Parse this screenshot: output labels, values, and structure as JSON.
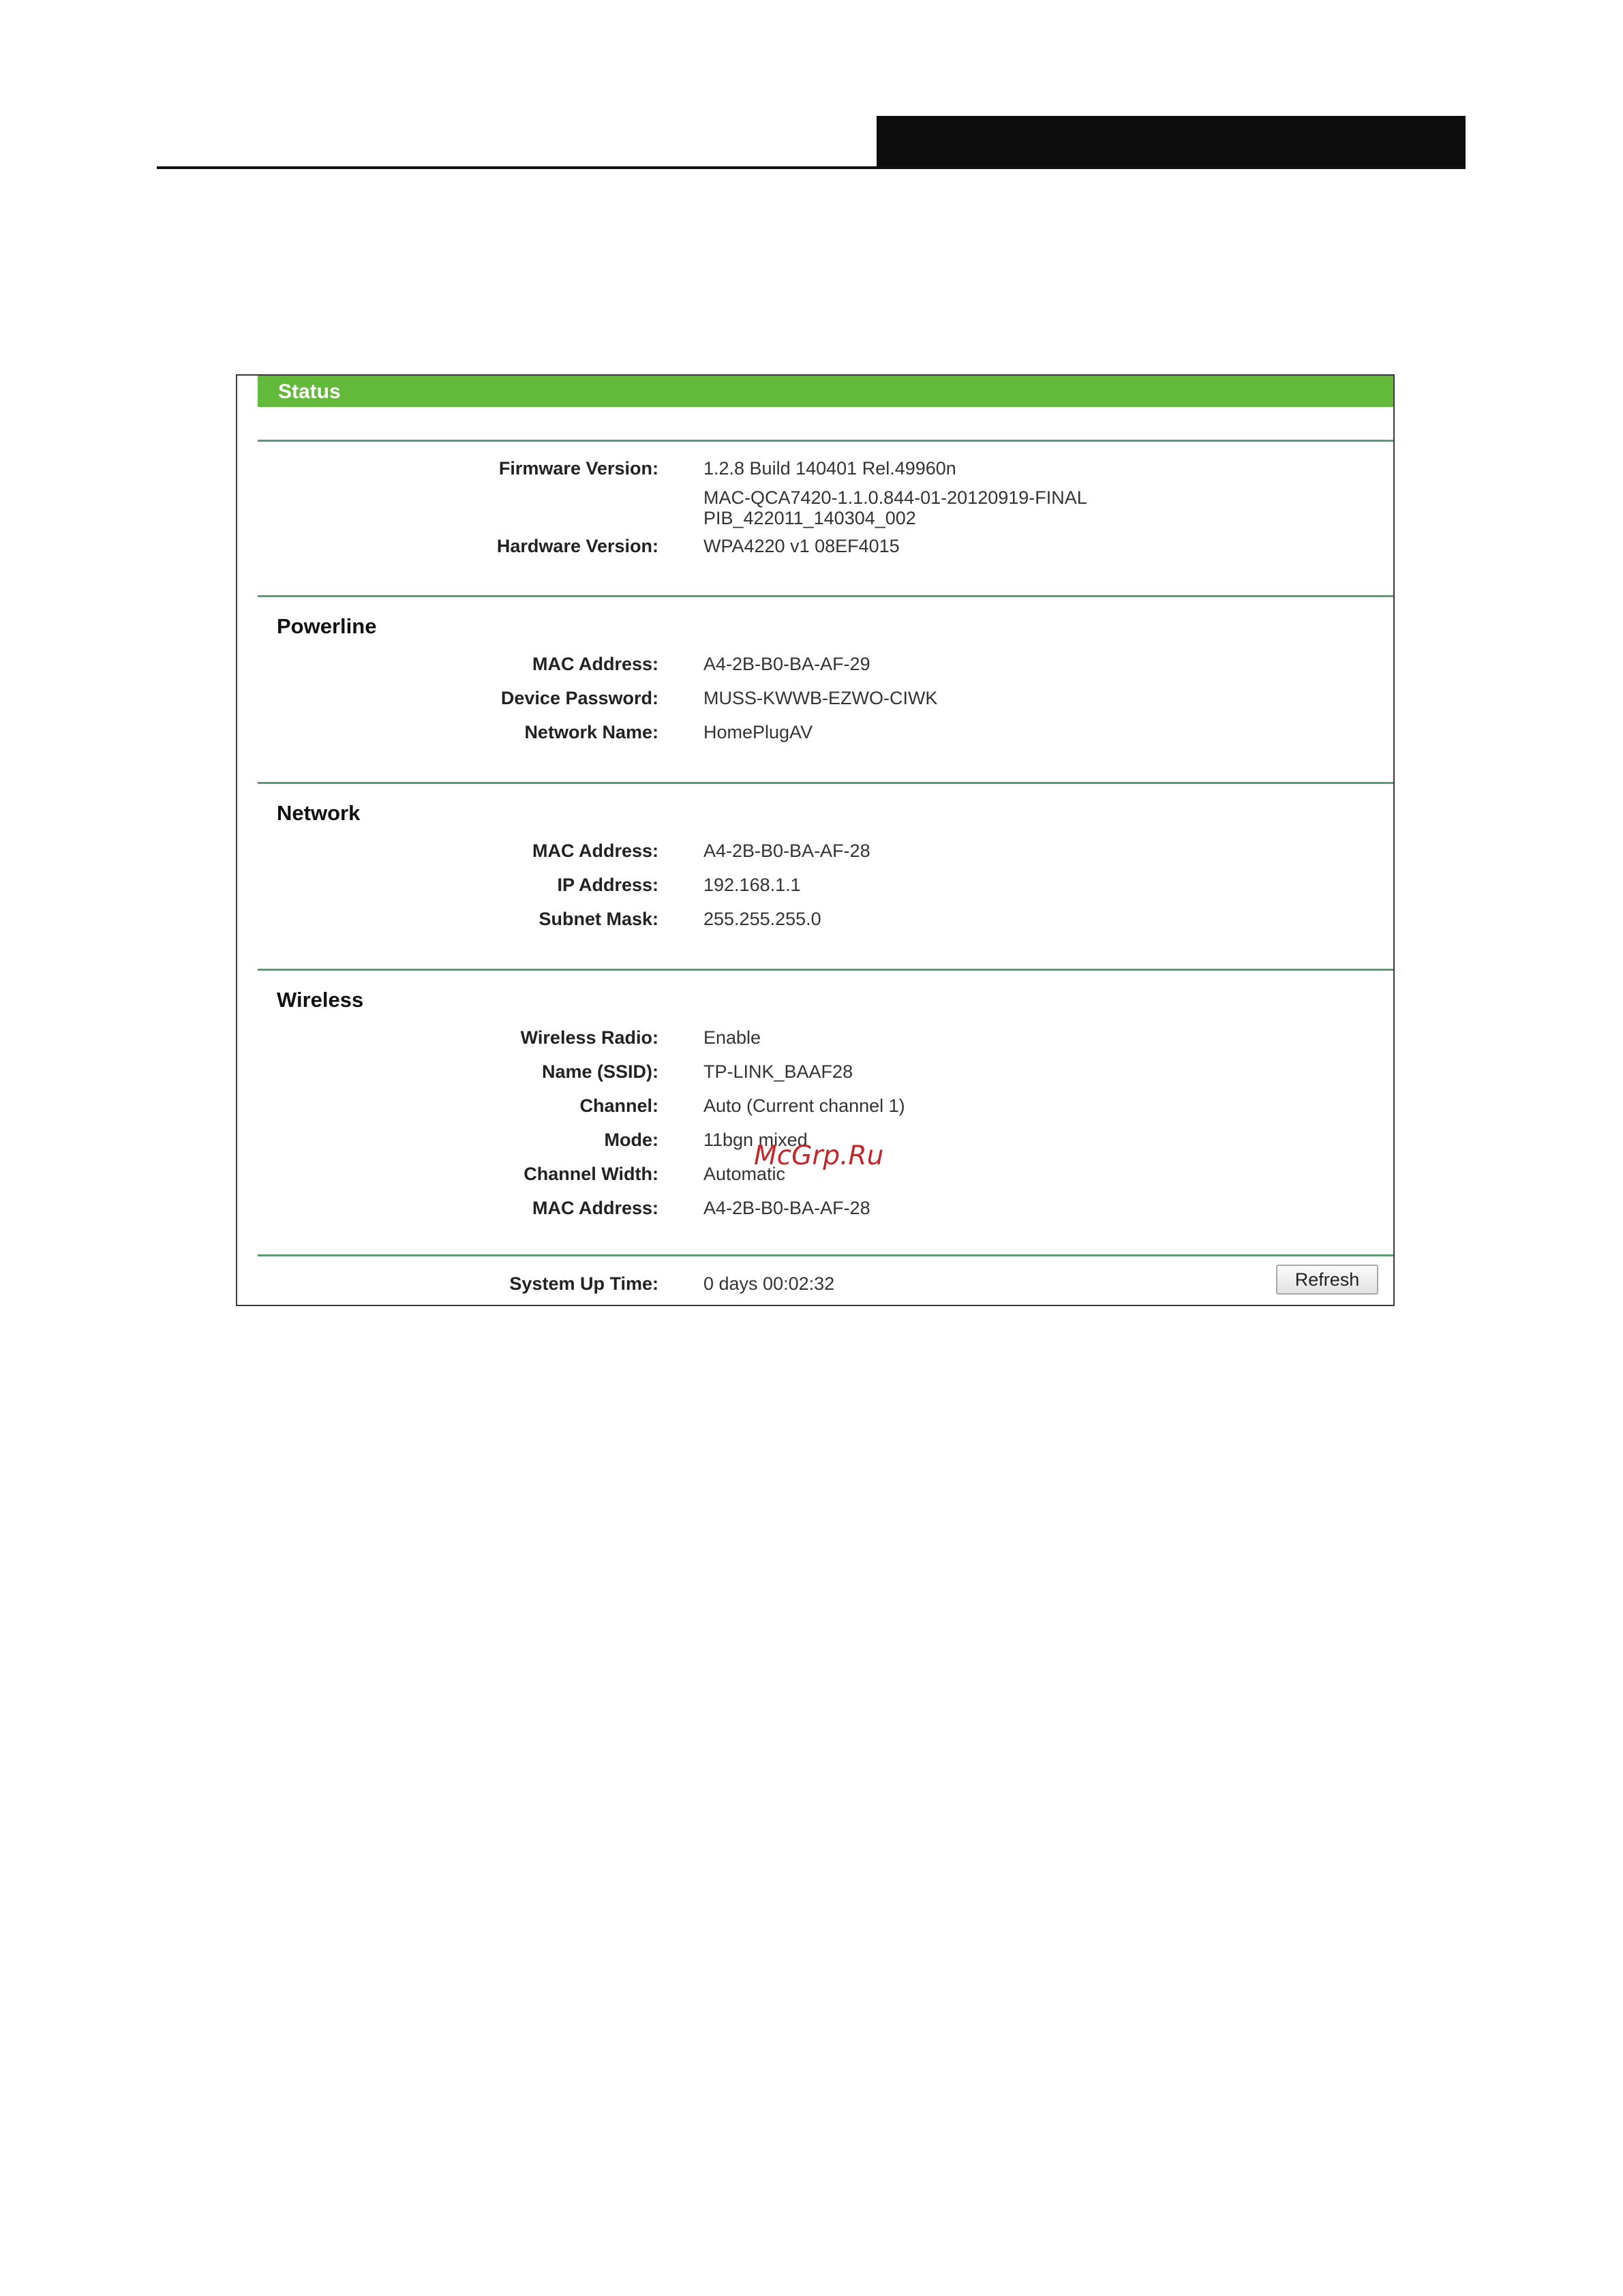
{
  "status": {
    "title": "Status",
    "firmware": {
      "label": "Firmware Version:",
      "value_line1": "1.2.8 Build 140401 Rel.49960n",
      "value_line2": "MAC-QCA7420-1.1.0.844-01-20120919-FINAL",
      "value_line3": "PIB_422011_140304_002"
    },
    "hardware": {
      "label": "Hardware Version:",
      "value": "WPA4220 v1 08EF4015"
    }
  },
  "powerline": {
    "title": "Powerline",
    "mac_label": "MAC Address:",
    "mac_value": "A4-2B-B0-BA-AF-29",
    "password_label": "Device Password:",
    "password_value": "MUSS-KWWB-EZWO-CIWK",
    "network_name_label": "Network Name:",
    "network_name_value": "HomePlugAV"
  },
  "network": {
    "title": "Network",
    "mac_label": "MAC Address:",
    "mac_value": "A4-2B-B0-BA-AF-28",
    "ip_label": "IP Address:",
    "ip_value": "192.168.1.1",
    "subnet_label": "Subnet Mask:",
    "subnet_value": "255.255.255.0"
  },
  "wireless": {
    "title": "Wireless",
    "radio_label": "Wireless Radio:",
    "radio_value": "Enable",
    "ssid_label": "Name (SSID):",
    "ssid_value": "TP-LINK_BAAF28",
    "channel_label": "Channel:",
    "channel_value": "Auto (Current channel 1)",
    "mode_label": "Mode:",
    "mode_value": "11bgn mixed",
    "width_label": "Channel Width:",
    "width_value": "Automatic",
    "mac_label": "MAC Address:",
    "mac_value": "A4-2B-B0-BA-AF-28"
  },
  "system": {
    "uptime_label": "System Up Time:",
    "uptime_value": "0 days 00:02:32",
    "refresh_label": "Refresh"
  },
  "watermark": "McGrp.Ru",
  "colors": {
    "header_green": "#63b93a",
    "rule_green": "#5b9a72",
    "watermark_red": "#c0282a"
  }
}
